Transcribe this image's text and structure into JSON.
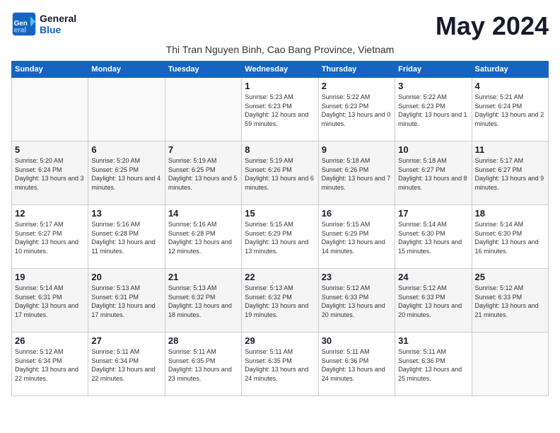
{
  "header": {
    "logo_line1": "General",
    "logo_line2": "Blue",
    "month_title": "May 2024",
    "location": "Thi Tran Nguyen Binh, Cao Bang Province, Vietnam"
  },
  "weekdays": [
    "Sunday",
    "Monday",
    "Tuesday",
    "Wednesday",
    "Thursday",
    "Friday",
    "Saturday"
  ],
  "weeks": [
    [
      {
        "day": "",
        "info": ""
      },
      {
        "day": "",
        "info": ""
      },
      {
        "day": "",
        "info": ""
      },
      {
        "day": "1",
        "info": "Sunrise: 5:23 AM\nSunset: 6:23 PM\nDaylight: 12 hours and 59 minutes."
      },
      {
        "day": "2",
        "info": "Sunrise: 5:22 AM\nSunset: 6:23 PM\nDaylight: 13 hours and 0 minutes."
      },
      {
        "day": "3",
        "info": "Sunrise: 5:22 AM\nSunset: 6:23 PM\nDaylight: 13 hours and 1 minute."
      },
      {
        "day": "4",
        "info": "Sunrise: 5:21 AM\nSunset: 6:24 PM\nDaylight: 13 hours and 2 minutes."
      }
    ],
    [
      {
        "day": "5",
        "info": "Sunrise: 5:20 AM\nSunset: 6:24 PM\nDaylight: 13 hours and 3 minutes."
      },
      {
        "day": "6",
        "info": "Sunrise: 5:20 AM\nSunset: 6:25 PM\nDaylight: 13 hours and 4 minutes."
      },
      {
        "day": "7",
        "info": "Sunrise: 5:19 AM\nSunset: 6:25 PM\nDaylight: 13 hours and 5 minutes."
      },
      {
        "day": "8",
        "info": "Sunrise: 5:19 AM\nSunset: 6:26 PM\nDaylight: 13 hours and 6 minutes."
      },
      {
        "day": "9",
        "info": "Sunrise: 5:18 AM\nSunset: 6:26 PM\nDaylight: 13 hours and 7 minutes."
      },
      {
        "day": "10",
        "info": "Sunrise: 5:18 AM\nSunset: 6:27 PM\nDaylight: 13 hours and 8 minutes."
      },
      {
        "day": "11",
        "info": "Sunrise: 5:17 AM\nSunset: 6:27 PM\nDaylight: 13 hours and 9 minutes."
      }
    ],
    [
      {
        "day": "12",
        "info": "Sunrise: 5:17 AM\nSunset: 6:27 PM\nDaylight: 13 hours and 10 minutes."
      },
      {
        "day": "13",
        "info": "Sunrise: 5:16 AM\nSunset: 6:28 PM\nDaylight: 13 hours and 11 minutes."
      },
      {
        "day": "14",
        "info": "Sunrise: 5:16 AM\nSunset: 6:28 PM\nDaylight: 13 hours and 12 minutes."
      },
      {
        "day": "15",
        "info": "Sunrise: 5:15 AM\nSunset: 6:29 PM\nDaylight: 13 hours and 13 minutes."
      },
      {
        "day": "16",
        "info": "Sunrise: 5:15 AM\nSunset: 6:29 PM\nDaylight: 13 hours and 14 minutes."
      },
      {
        "day": "17",
        "info": "Sunrise: 5:14 AM\nSunset: 6:30 PM\nDaylight: 13 hours and 15 minutes."
      },
      {
        "day": "18",
        "info": "Sunrise: 5:14 AM\nSunset: 6:30 PM\nDaylight: 13 hours and 16 minutes."
      }
    ],
    [
      {
        "day": "19",
        "info": "Sunrise: 5:14 AM\nSunset: 6:31 PM\nDaylight: 13 hours and 17 minutes."
      },
      {
        "day": "20",
        "info": "Sunrise: 5:13 AM\nSunset: 6:31 PM\nDaylight: 13 hours and 17 minutes."
      },
      {
        "day": "21",
        "info": "Sunrise: 5:13 AM\nSunset: 6:32 PM\nDaylight: 13 hours and 18 minutes."
      },
      {
        "day": "22",
        "info": "Sunrise: 5:13 AM\nSunset: 6:32 PM\nDaylight: 13 hours and 19 minutes."
      },
      {
        "day": "23",
        "info": "Sunrise: 5:12 AM\nSunset: 6:33 PM\nDaylight: 13 hours and 20 minutes."
      },
      {
        "day": "24",
        "info": "Sunrise: 5:12 AM\nSunset: 6:33 PM\nDaylight: 13 hours and 20 minutes."
      },
      {
        "day": "25",
        "info": "Sunrise: 5:12 AM\nSunset: 6:33 PM\nDaylight: 13 hours and 21 minutes."
      }
    ],
    [
      {
        "day": "26",
        "info": "Sunrise: 5:12 AM\nSunset: 6:34 PM\nDaylight: 13 hours and 22 minutes."
      },
      {
        "day": "27",
        "info": "Sunrise: 5:11 AM\nSunset: 6:34 PM\nDaylight: 13 hours and 22 minutes."
      },
      {
        "day": "28",
        "info": "Sunrise: 5:11 AM\nSunset: 6:35 PM\nDaylight: 13 hours and 23 minutes."
      },
      {
        "day": "29",
        "info": "Sunrise: 5:11 AM\nSunset: 6:35 PM\nDaylight: 13 hours and 24 minutes."
      },
      {
        "day": "30",
        "info": "Sunrise: 5:11 AM\nSunset: 6:36 PM\nDaylight: 13 hours and 24 minutes."
      },
      {
        "day": "31",
        "info": "Sunrise: 5:11 AM\nSunset: 6:36 PM\nDaylight: 13 hours and 25 minutes."
      },
      {
        "day": "",
        "info": ""
      }
    ]
  ]
}
